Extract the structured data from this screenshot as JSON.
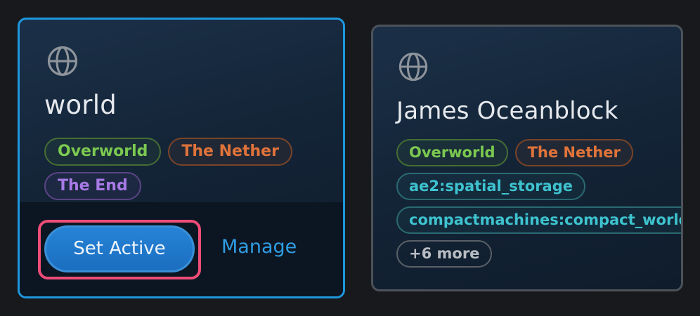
{
  "worlds": [
    {
      "icon": "globe-icon",
      "name": "world",
      "tags": [
        {
          "label": "Overworld",
          "kind": "overworld"
        },
        {
          "label": "The Nether",
          "kind": "nether"
        },
        {
          "label": "The End",
          "kind": "end"
        }
      ],
      "primary_action": "Set Active",
      "secondary_action": "Manage",
      "selected": true
    },
    {
      "icon": "globe-icon",
      "name": "James Oceanblock",
      "tags": [
        {
          "label": "Overworld",
          "kind": "overworld"
        },
        {
          "label": "The Nether",
          "kind": "nether"
        },
        {
          "label": "ae2:spatial_storage",
          "kind": "modded"
        },
        {
          "label": "compactmachines:compact_world",
          "kind": "modded"
        },
        {
          "label": "+6 more",
          "kind": "more"
        }
      ],
      "selected": false
    }
  ],
  "colors": {
    "selected_border": "#1e97de",
    "highlight": "#ee4d78",
    "primary_button": "#1b6ec0",
    "link": "#2f9de4"
  }
}
